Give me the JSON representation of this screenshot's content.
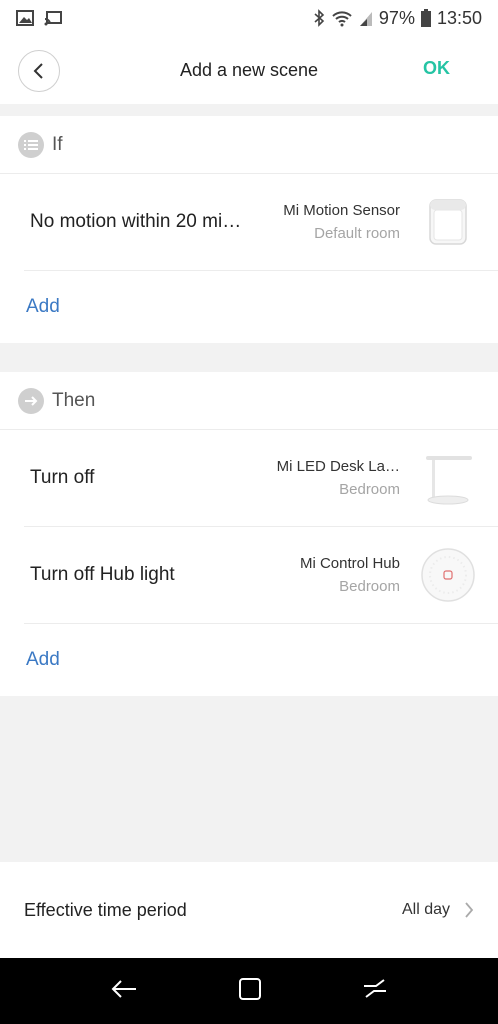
{
  "status_bar": {
    "battery": "97%",
    "time": "13:50",
    "icons": [
      "image-icon",
      "cast-icon",
      "bluetooth-icon",
      "wifi-icon",
      "signal-icon",
      "battery-icon"
    ]
  },
  "header": {
    "title": "Add a new scene",
    "ok_label": "OK",
    "accent_color": "#25c4a4"
  },
  "if_section": {
    "label": "If",
    "conditions": [
      {
        "title": "No motion within 20 mi…",
        "device": "Mi Motion Sensor",
        "room": "Default room",
        "thumb": "motion-sensor"
      }
    ],
    "add_label": "Add"
  },
  "then_section": {
    "label": "Then",
    "actions": [
      {
        "title": "Turn off",
        "device": "Mi LED Desk La…",
        "room": "Bedroom",
        "thumb": "desk-lamp"
      },
      {
        "title": "Turn off Hub light",
        "device": "Mi Control Hub",
        "room": "Bedroom",
        "thumb": "control-hub"
      }
    ],
    "add_label": "Add"
  },
  "period": {
    "label": "Effective time period",
    "value": "All day"
  },
  "link_color": "#3b79c4"
}
